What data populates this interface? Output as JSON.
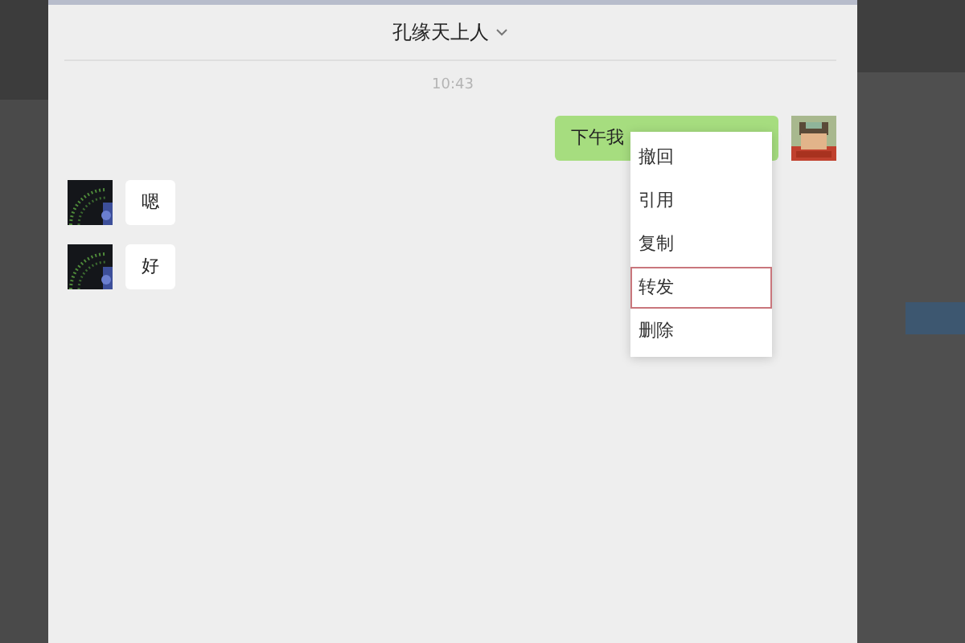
{
  "chat": {
    "title": "孔缘天上人",
    "time": "10:43",
    "messages": [
      {
        "kind": "outgoing",
        "text": "下午我"
      },
      {
        "kind": "incoming",
        "text": "嗯"
      },
      {
        "kind": "incoming",
        "text": "好"
      }
    ]
  },
  "context_menu": {
    "items": [
      {
        "label": "撤回",
        "selected": false
      },
      {
        "label": "引用",
        "selected": false
      },
      {
        "label": "复制",
        "selected": false
      },
      {
        "label": "转发",
        "selected": true
      },
      {
        "label": "删除",
        "selected": false
      }
    ]
  }
}
